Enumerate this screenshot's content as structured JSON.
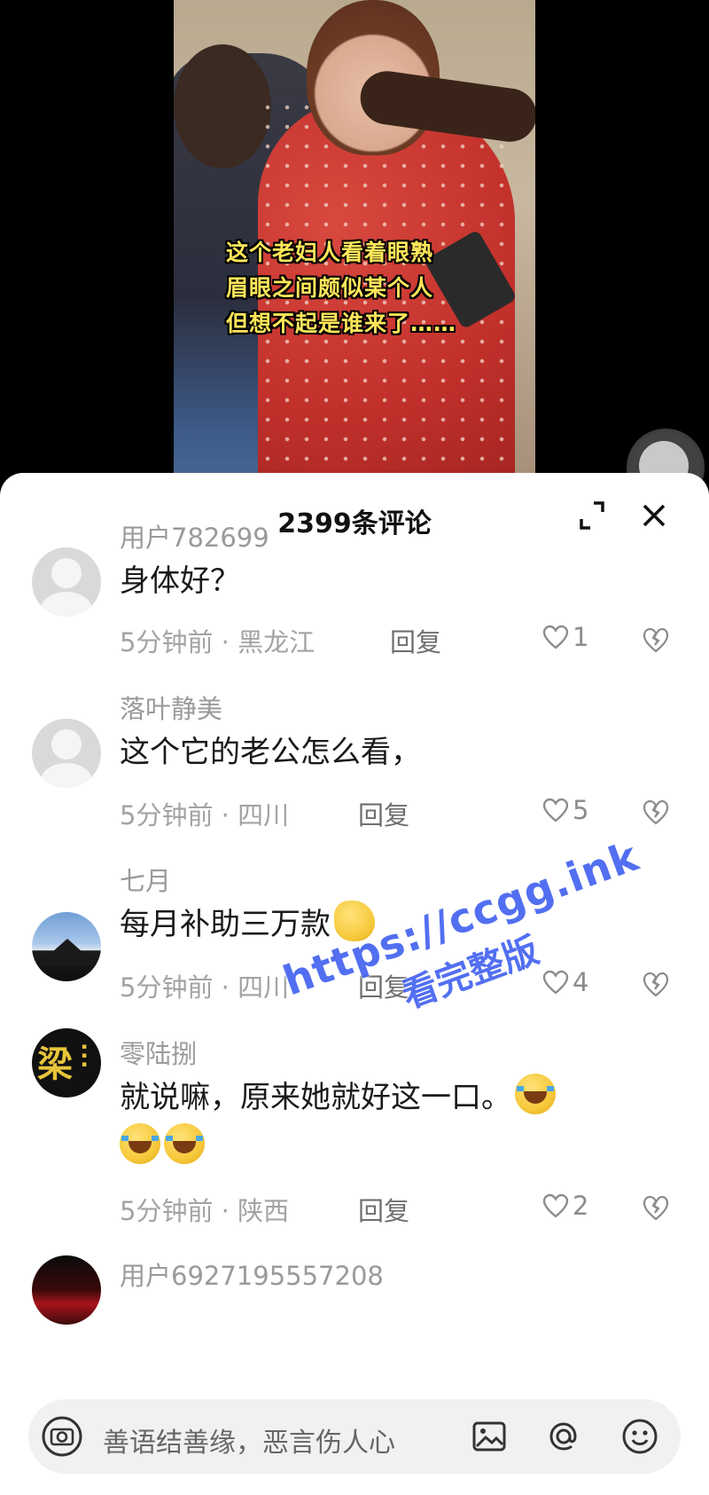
{
  "video": {
    "caption_lines": [
      "这个老妇人看着眼熟",
      "眉眼之间颇似某个人",
      "但想不起是谁来了……"
    ]
  },
  "comments_panel": {
    "title": "2399条评论"
  },
  "comments": [
    {
      "username": "用户782699",
      "text": "身体好？",
      "time_location": "5分钟前 · 黑龙江",
      "reply_label": "回复",
      "likes": "1"
    },
    {
      "username": "落叶静美",
      "text": "这个它的老公怎么看，",
      "time_location": "5分钟前 · 四川",
      "reply_label": "回复",
      "likes": "5"
    },
    {
      "username": "七月",
      "text": "每月补助三万款",
      "time_location": "5分钟前 · 四川",
      "reply_label": "回复",
      "likes": "4"
    },
    {
      "username": "零陆捌",
      "text": "就说嘛，原来她就好这一口。",
      "time_location": "5分钟前 · 陕西",
      "reply_label": "回复",
      "likes": "2"
    },
    {
      "username": "用户6927195557208"
    }
  ],
  "watermark": {
    "url": "https://ccgg.ink",
    "text": "看完整版"
  },
  "input_bar": {
    "placeholder": "善语结善缘，恶言伤人心"
  },
  "avatar_glyph": "梁",
  "icons": {
    "expand": "expand-icon",
    "close": "close-icon",
    "like": "heart-outline-icon",
    "dislike": "broken-heart-icon",
    "camera": "camera-icon",
    "image": "image-icon",
    "at": "at-sign-icon",
    "emoji": "smiley-icon"
  },
  "colors": {
    "caption": "#ffe65a",
    "watermark": "#3b5cf0",
    "username": "#9a9a9a",
    "meta": "#a3a3a3"
  }
}
